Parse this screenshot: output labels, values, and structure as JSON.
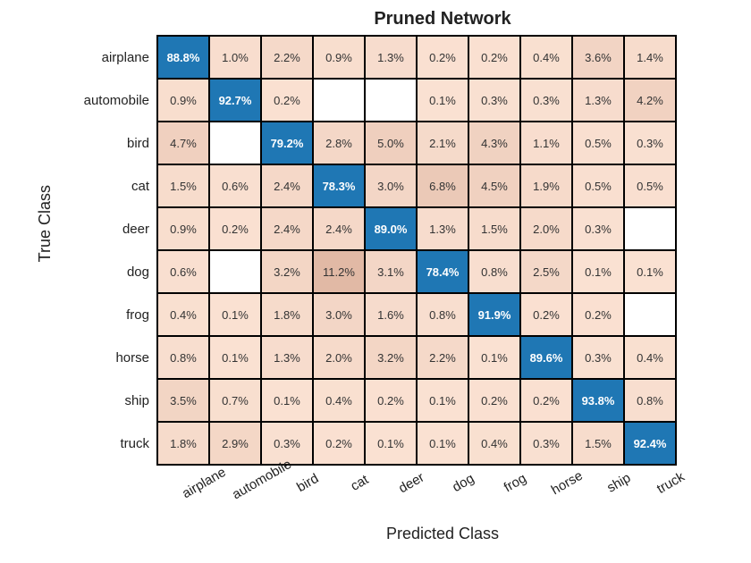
{
  "chart_data": {
    "type": "heatmap",
    "title": "Pruned Network",
    "xlabel": "Predicted Class",
    "ylabel": "True Class",
    "classes": [
      "airplane",
      "automobile",
      "bird",
      "cat",
      "deer",
      "dog",
      "frog",
      "horse",
      "ship",
      "truck"
    ],
    "values": [
      [
        88.8,
        1.0,
        2.2,
        0.9,
        1.3,
        0.2,
        0.2,
        0.4,
        3.6,
        1.4
      ],
      [
        0.9,
        92.7,
        0.2,
        null,
        null,
        0.1,
        0.3,
        0.3,
        1.3,
        4.2
      ],
      [
        4.7,
        null,
        79.2,
        2.8,
        5.0,
        2.1,
        4.3,
        1.1,
        0.5,
        0.3
      ],
      [
        1.5,
        0.6,
        2.4,
        78.3,
        3.0,
        6.8,
        4.5,
        1.9,
        0.5,
        0.5
      ],
      [
        0.9,
        0.2,
        2.4,
        2.4,
        89.0,
        1.3,
        1.5,
        2.0,
        0.3,
        null
      ],
      [
        0.6,
        null,
        3.2,
        11.2,
        3.1,
        78.4,
        0.8,
        2.5,
        0.1,
        0.1
      ],
      [
        0.4,
        0.1,
        1.8,
        3.0,
        1.6,
        0.8,
        91.9,
        0.2,
        0.2,
        null
      ],
      [
        0.8,
        0.1,
        1.3,
        2.0,
        3.2,
        2.2,
        0.1,
        89.6,
        0.3,
        0.4
      ],
      [
        3.5,
        0.7,
        0.1,
        0.4,
        0.2,
        0.1,
        0.2,
        0.2,
        93.8,
        0.8
      ],
      [
        1.8,
        2.9,
        0.3,
        0.2,
        0.1,
        0.1,
        0.4,
        0.3,
        1.5,
        92.4
      ]
    ],
    "unit": "%",
    "colors": {
      "diagonal": "#1f77b4",
      "offdiag_base": "#f3d9cd",
      "empty": "#ffffff"
    }
  }
}
